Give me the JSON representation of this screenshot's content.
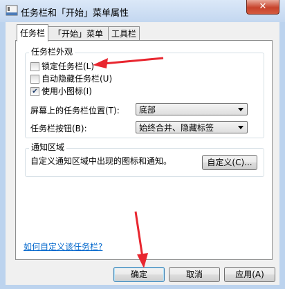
{
  "window": {
    "title": "任务栏和「开始」菜单属性",
    "close_label": "✕"
  },
  "tabs": [
    {
      "label": "任务栏",
      "active": true
    },
    {
      "label": "「开始」菜单",
      "active": false
    },
    {
      "label": "工具栏",
      "active": false
    }
  ],
  "appearance": {
    "group_label": "任务栏外观",
    "lock_taskbar": {
      "label": "锁定任务栏(L)",
      "checked": false
    },
    "auto_hide": {
      "label": "自动隐藏任务栏(U)",
      "checked": false
    },
    "small_icons": {
      "label": "使用小图标(I)",
      "checked": true
    },
    "location": {
      "label": "屏幕上的任务栏位置(T):",
      "value": "底部"
    },
    "buttons": {
      "label": "任务栏按钮(B):",
      "value": "始终合并、隐藏标签"
    }
  },
  "notification": {
    "group_label": "通知区域",
    "description": "自定义通知区域中出现的图标和通知。",
    "customize_label": "自定义(C)..."
  },
  "help_link": "如何自定义该任务栏?",
  "footer": {
    "ok_label": "确定",
    "cancel_label": "取消",
    "apply_label": "应用(A)"
  },
  "colors": {
    "annotation_arrow": "#e8262f",
    "link": "#0066cc"
  }
}
